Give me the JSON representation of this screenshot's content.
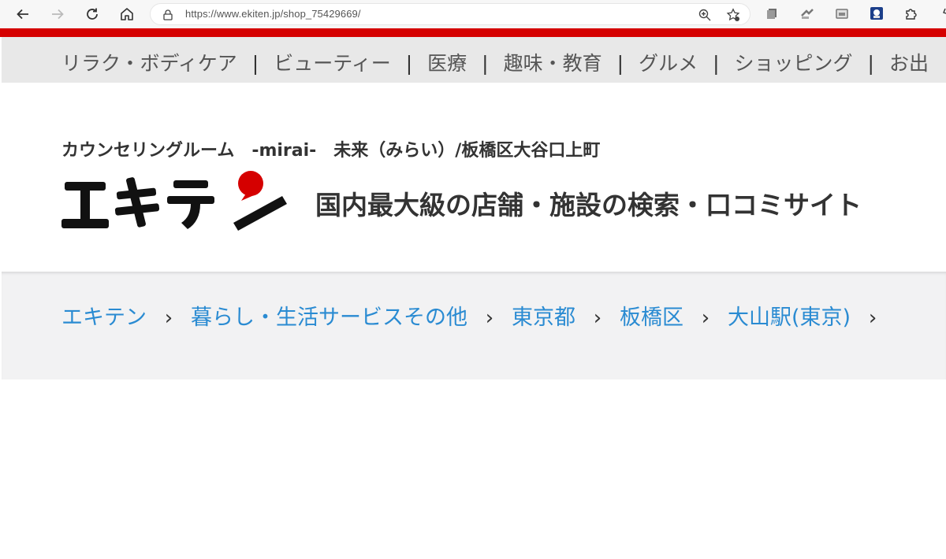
{
  "browser": {
    "url": "https://www.ekiten.jp/shop_75429669/",
    "icons": [
      "back-icon",
      "forward-icon",
      "reload-icon",
      "home-icon",
      "lock-icon",
      "zoom-icon",
      "favorite-icon",
      "collections-icon",
      "extension-icon",
      "puzzle-icon"
    ]
  },
  "colors": {
    "brand_red": "#d50000",
    "link_blue": "#2a8bd2",
    "nav_bg": "#e8e8e8",
    "crumb_bg": "#f2f2f3"
  },
  "category_nav": {
    "items": [
      {
        "label": "リラク・ボディケア"
      },
      {
        "label": "ビューティー"
      },
      {
        "label": "医療"
      },
      {
        "label": "趣味・教育"
      },
      {
        "label": "グルメ"
      },
      {
        "label": "ショッピング"
      },
      {
        "label": "お出"
      }
    ],
    "separator": "|"
  },
  "header": {
    "shop_title": "カウンセリングルーム　-mirai-　未来（みらい）/板橋区大谷口上町",
    "logo_text": "エキテン",
    "tagline": "国内最大級の店舗・施設の検索・口コミサイト"
  },
  "breadcrumb": {
    "items": [
      {
        "label": "エキテン"
      },
      {
        "label": "暮らし・生活サービスその他"
      },
      {
        "label": "東京都"
      },
      {
        "label": "板橋区"
      },
      {
        "label": "大山駅(東京)"
      }
    ],
    "separator": "›"
  }
}
